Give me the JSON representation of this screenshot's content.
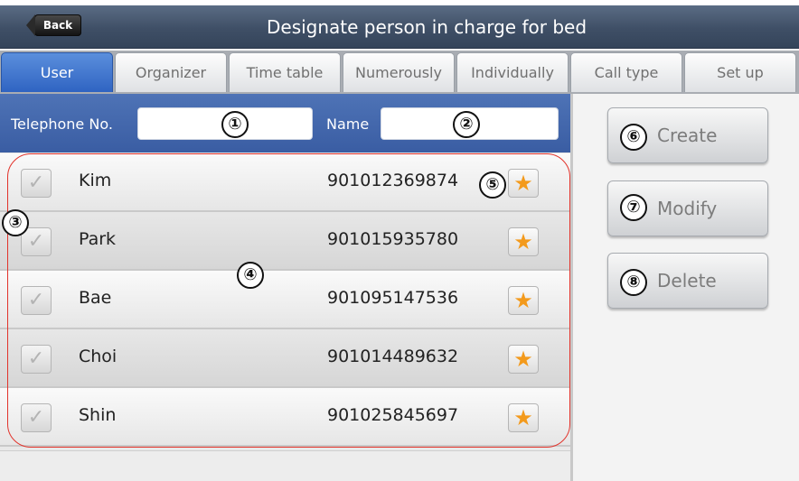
{
  "header": {
    "back_label": "Back",
    "title": "Designate person in charge for bed"
  },
  "tabs": [
    {
      "label": "User",
      "active": true
    },
    {
      "label": "Organizer",
      "active": false
    },
    {
      "label": "Time table",
      "active": false
    },
    {
      "label": "Numerously",
      "active": false
    },
    {
      "label": "Individually",
      "active": false
    },
    {
      "label": "Call type",
      "active": false
    },
    {
      "label": "Set up",
      "active": false
    }
  ],
  "search": {
    "telephone_label": "Telephone No.",
    "telephone_value": "",
    "name_label": "Name",
    "name_value": ""
  },
  "users": [
    {
      "name": "Kim",
      "phone": "901012369874",
      "checked": true
    },
    {
      "name": "Park",
      "phone": "901015935780",
      "checked": true
    },
    {
      "name": "Bae",
      "phone": "901095147536",
      "checked": true
    },
    {
      "name": "Choi",
      "phone": "901014489632",
      "checked": true
    },
    {
      "name": "Shin",
      "phone": "901025845697",
      "checked": true
    }
  ],
  "icons": {
    "checkbox": "checkmark-icon",
    "favorite": "star-icon",
    "check_glyph": "✓",
    "star_glyph": "★"
  },
  "actions": {
    "create": "Create",
    "modify": "Modify",
    "delete": "Delete"
  },
  "annotations": [
    "①",
    "②",
    "③",
    "④",
    "⑤",
    "⑥",
    "⑦",
    "⑧"
  ],
  "colors": {
    "accent": "#3a64b8",
    "star": "#f39a1c",
    "annotation_outline": "#e2332b"
  }
}
